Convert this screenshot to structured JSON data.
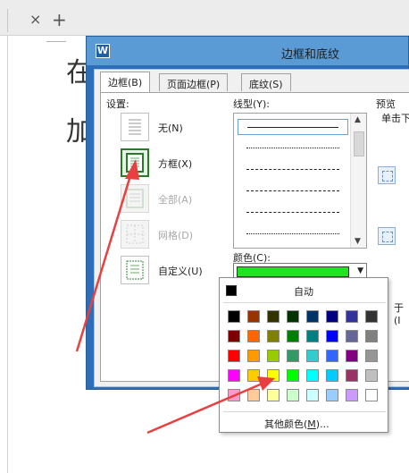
{
  "window": {
    "close_glyph": "×",
    "new_tab_glyph": "+"
  },
  "document": {
    "line1": "在",
    "line2": "加"
  },
  "dialog": {
    "app_icon": "W",
    "title": "边框和底纹"
  },
  "tabs": [
    {
      "label": "边框(B)",
      "active": true
    },
    {
      "label": "页面边框(P)",
      "active": false
    },
    {
      "label": "底纹(S)",
      "active": false
    }
  ],
  "settings": {
    "label": "设置:",
    "items": [
      {
        "label": "无(N)",
        "selected": false,
        "disabled": false
      },
      {
        "label": "方框(X)",
        "selected": true,
        "disabled": false
      },
      {
        "label": "全部(A)",
        "selected": false,
        "disabled": true
      },
      {
        "label": "网格(D)",
        "selected": false,
        "disabled": true
      },
      {
        "label": "自定义(U)",
        "selected": false,
        "disabled": false
      }
    ]
  },
  "line_style": {
    "label": "线型(Y):",
    "styles": [
      "solid",
      "dotted",
      "dashed",
      "dashed",
      "dash-dot",
      "dash-dot"
    ]
  },
  "color": {
    "label": "颜色(C):",
    "value": "#22e322"
  },
  "preview": {
    "label": "预览",
    "hint": "单击下方",
    "apply_label": "于(I"
  },
  "color_popup": {
    "auto_label": "自动",
    "auto_color": "#000000",
    "more_label_prefix": "其他颜色(",
    "more_label_key": "M",
    "more_label_suffix": ")...",
    "rows": [
      [
        "#000000",
        "#993300",
        "#333300",
        "#003300",
        "#003366",
        "#000080",
        "#333399",
        "#333333"
      ],
      [
        "#800000",
        "#ff6600",
        "#808000",
        "#008000",
        "#008080",
        "#0000ff",
        "#666699",
        "#808080"
      ],
      [
        "#ff0000",
        "#ff9900",
        "#99cc00",
        "#339966",
        "#33cccc",
        "#3366ff",
        "#800080",
        "#969696"
      ],
      [
        "#ff00ff",
        "#ffcc00",
        "#ffff00",
        "#00ff00",
        "#00ffff",
        "#00ccff",
        "#993366",
        "#c0c0c0"
      ],
      [
        "#ff99cc",
        "#ffcc99",
        "#ffff99",
        "#ccffcc",
        "#ccffff",
        "#99ccff",
        "#cc99ff",
        "#ffffff"
      ]
    ]
  },
  "annotation_color": "#e84040"
}
